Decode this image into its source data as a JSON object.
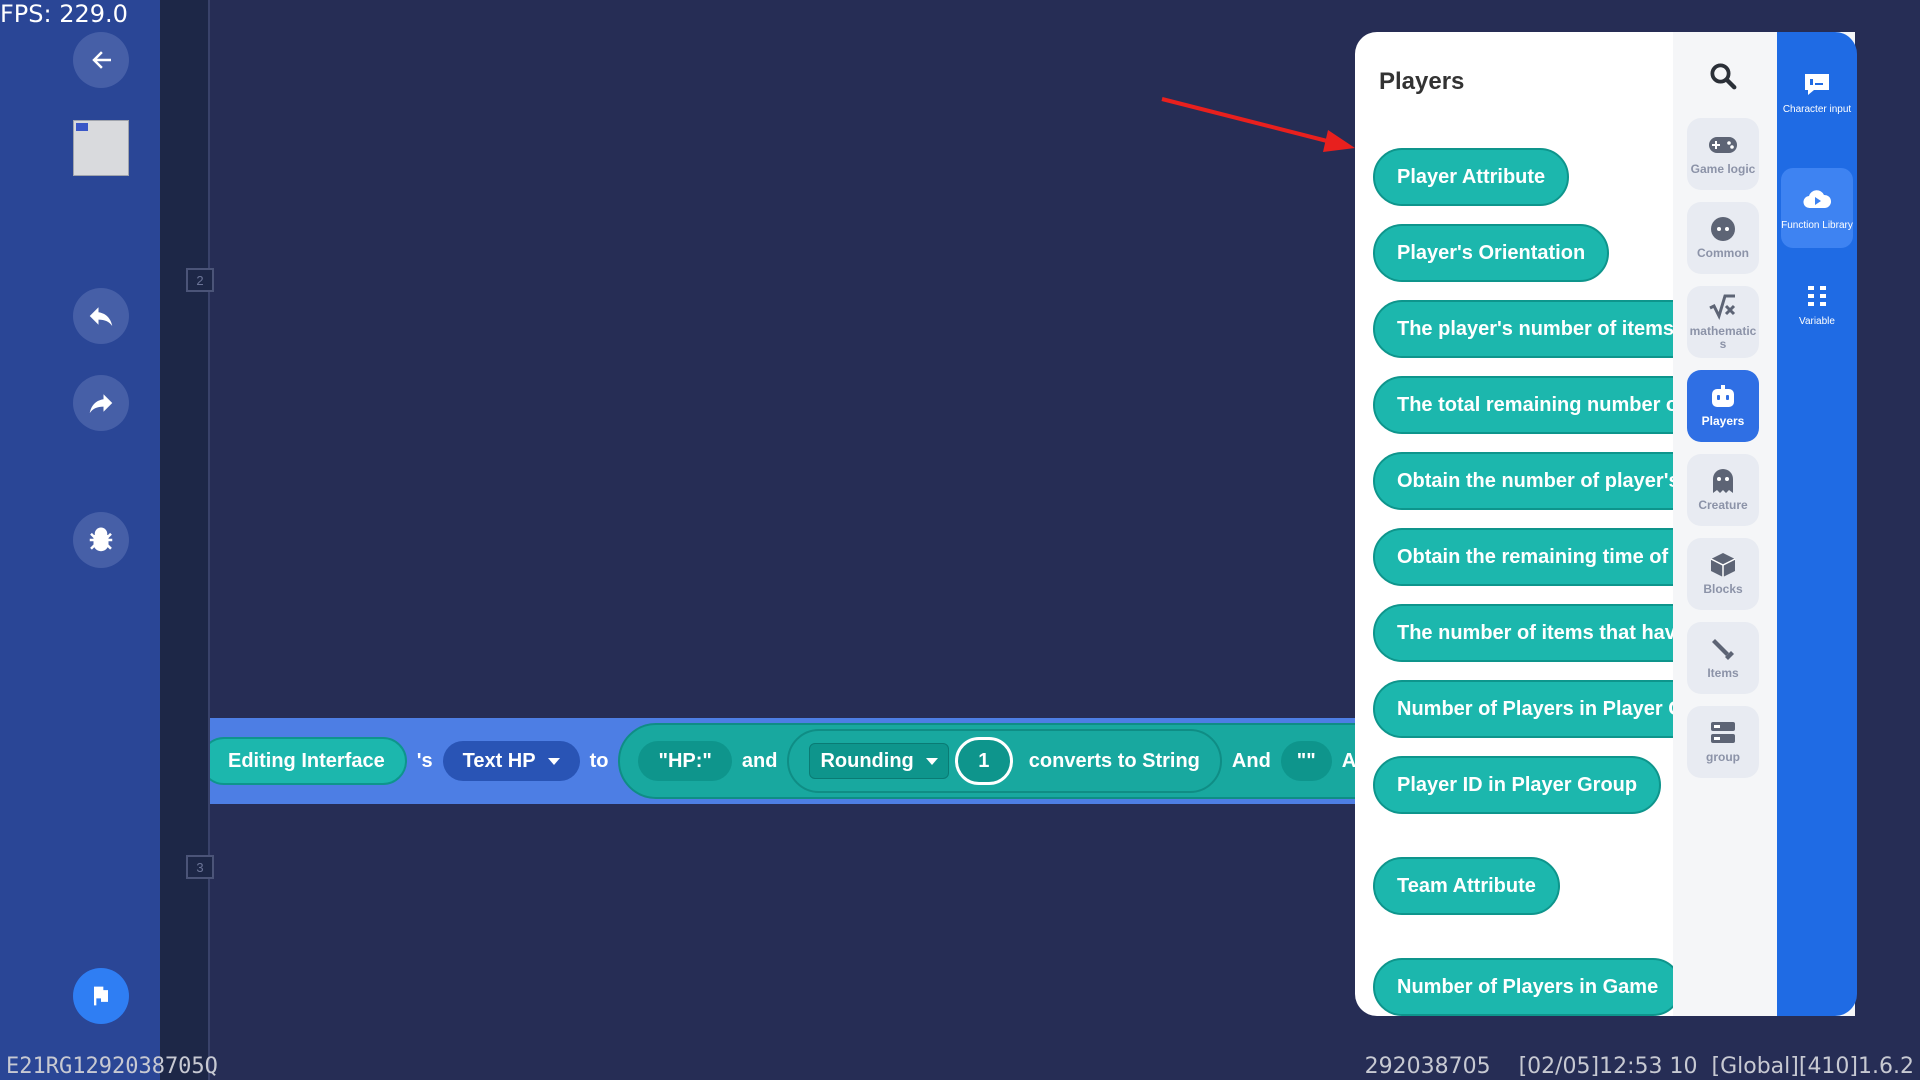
{
  "fps": "FPS: 229.0",
  "gutter": {
    "line_numbers": [
      "2",
      "3"
    ]
  },
  "code": {
    "target": "Editing Interface",
    "possessive": "'s",
    "property": "Text HP",
    "to": "to",
    "string1": "\"HP:\"",
    "and1": "and",
    "func": "Rounding",
    "num": "1",
    "converts": "converts to String",
    "and2": "And",
    "string2": "\"\"",
    "and3": "And"
  },
  "palette": {
    "title": "Players",
    "blocks": [
      "Player Attribute",
      "Player's Orientation",
      "The player's number of items",
      "The total remaining number of",
      "Obtain the number of player's it",
      "Obtain the remaining time of th",
      "The number of items that have",
      "Number of Players in Player Gr",
      "Player ID in Player Group",
      "Team Attribute",
      "Number of Players in Game"
    ],
    "categories": [
      {
        "label": "Game logic",
        "icon": "gamepad-icon"
      },
      {
        "label": "Common",
        "icon": "dots-icon"
      },
      {
        "label": "mathematic s",
        "icon": "sqrt-icon"
      },
      {
        "label": "Players",
        "icon": "robot-icon"
      },
      {
        "label": "Creature",
        "icon": "ghost-icon"
      },
      {
        "label": "Blocks",
        "icon": "cube-icon"
      },
      {
        "label": "Items",
        "icon": "sword-icon"
      },
      {
        "label": "group",
        "icon": "group-icon"
      }
    ]
  },
  "right_tabs": [
    {
      "label": "Character input",
      "icon": "chat-icon"
    },
    {
      "label": "Function Library",
      "icon": "cloud-play-icon"
    },
    {
      "label": "Variable",
      "icon": "grid-icon"
    }
  ],
  "footer": {
    "left": "E21RG1292038705Q",
    "right": "292038705    [02/05]12:53 10  [Global][410]1.6.2"
  },
  "colors": {
    "background": "#262d55",
    "left_bar": "#2a4696",
    "block_teal": "#1cb7ad",
    "active_tab": "#2f6fe4",
    "annotation_arrow": "#e8201e"
  }
}
